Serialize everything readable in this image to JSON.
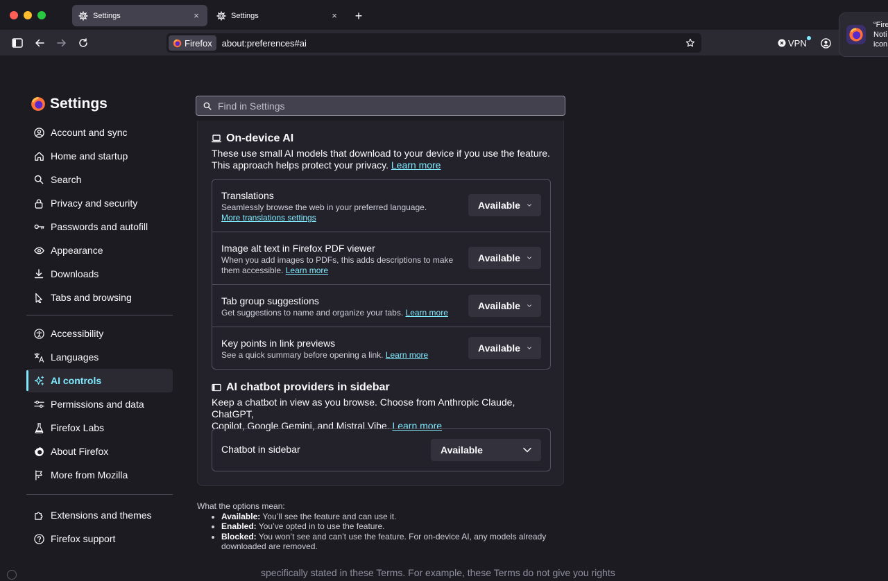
{
  "tabs": [
    {
      "label": "Settings",
      "close": "×"
    },
    {
      "label": "Settings",
      "close": "×"
    }
  ],
  "new_tab": "+",
  "notification": {
    "text": "“Fire\nNoti\nicon"
  },
  "toolbar": {
    "identity_label": "Firefox",
    "url": "about:preferences#ai",
    "vpn_label": "VPN"
  },
  "sidebar": {
    "title": "Settings",
    "group1": [
      {
        "label": "Account and sync",
        "icon": "account-icon"
      },
      {
        "label": "Home and startup",
        "icon": "home-icon"
      },
      {
        "label": "Search",
        "icon": "search-icon"
      },
      {
        "label": "Privacy and security",
        "icon": "lock-icon"
      },
      {
        "label": "Passwords and autofill",
        "icon": "key-icon"
      },
      {
        "label": "Appearance",
        "icon": "eye-icon"
      },
      {
        "label": "Downloads",
        "icon": "download-icon"
      },
      {
        "label": "Tabs and browsing",
        "icon": "pointer-icon"
      }
    ],
    "group2": [
      {
        "label": "Accessibility",
        "icon": "accessibility-icon"
      },
      {
        "label": "Languages",
        "icon": "translate-icon"
      },
      {
        "label": "AI controls",
        "icon": "sparkle-icon",
        "selected": true
      },
      {
        "label": "Permissions and data",
        "icon": "sliders-icon"
      },
      {
        "label": "Firefox Labs",
        "icon": "flask-icon"
      },
      {
        "label": "About Firefox",
        "icon": "firefox-icon"
      },
      {
        "label": "More from Mozilla",
        "icon": "flag-icon"
      }
    ],
    "group3": [
      {
        "label": "Extensions and themes",
        "icon": "puzzle-icon"
      },
      {
        "label": "Firefox support",
        "icon": "help-icon"
      }
    ]
  },
  "search": {
    "placeholder": "Find in Settings"
  },
  "ondevice": {
    "title": "On-device AI",
    "desc1": "These use small AI models that download to your device if you use the feature.",
    "desc2": "This approach helps protect your privacy.",
    "learn_more": "Learn more",
    "rows": [
      {
        "title": "Translations",
        "desc": "Seamlessly browse the web in your preferred language.",
        "link": "More translations settings",
        "value": "Available"
      },
      {
        "title": "Image alt text in Firefox PDF viewer",
        "desc1": "When you add images to PDFs, this adds descriptions to make",
        "desc2": "them accessible.",
        "link": "Learn more",
        "value": "Available"
      },
      {
        "title": "Tab group suggestions",
        "desc": "Get suggestions to name and organize your tabs.",
        "link": "Learn more",
        "value": "Available"
      },
      {
        "title": "Key points in link previews",
        "desc": "See a quick summary before opening a link.",
        "link": "Learn more",
        "value": "Available"
      }
    ]
  },
  "chatbot": {
    "title": "AI chatbot providers in sidebar",
    "desc1": "Keep a chatbot in view as you browse. Choose from Anthropic Claude, ChatGPT,",
    "desc2": "Copilot, Google Gemini, and Mistral Vibe.",
    "learn_more": "Learn more",
    "row_title": "Chatbot in sidebar",
    "value": "Available"
  },
  "footnote": {
    "heading": "What the options mean:",
    "items": [
      {
        "term": "Available:",
        "text": " You’ll see the feature and can use it."
      },
      {
        "term": "Enabled:",
        "text": " You’ve opted in to use the feature."
      },
      {
        "term": "Blocked:",
        "text": " You won’t see and can’t use the feature. For on-device AI, any models already downloaded are removed."
      }
    ]
  },
  "bottom_text": "specifically stated in these Terms. For example, these Terms do not give you rights",
  "colors": {
    "accent": "#80ebff",
    "background": "#1c1b22",
    "card": "#23222b"
  }
}
